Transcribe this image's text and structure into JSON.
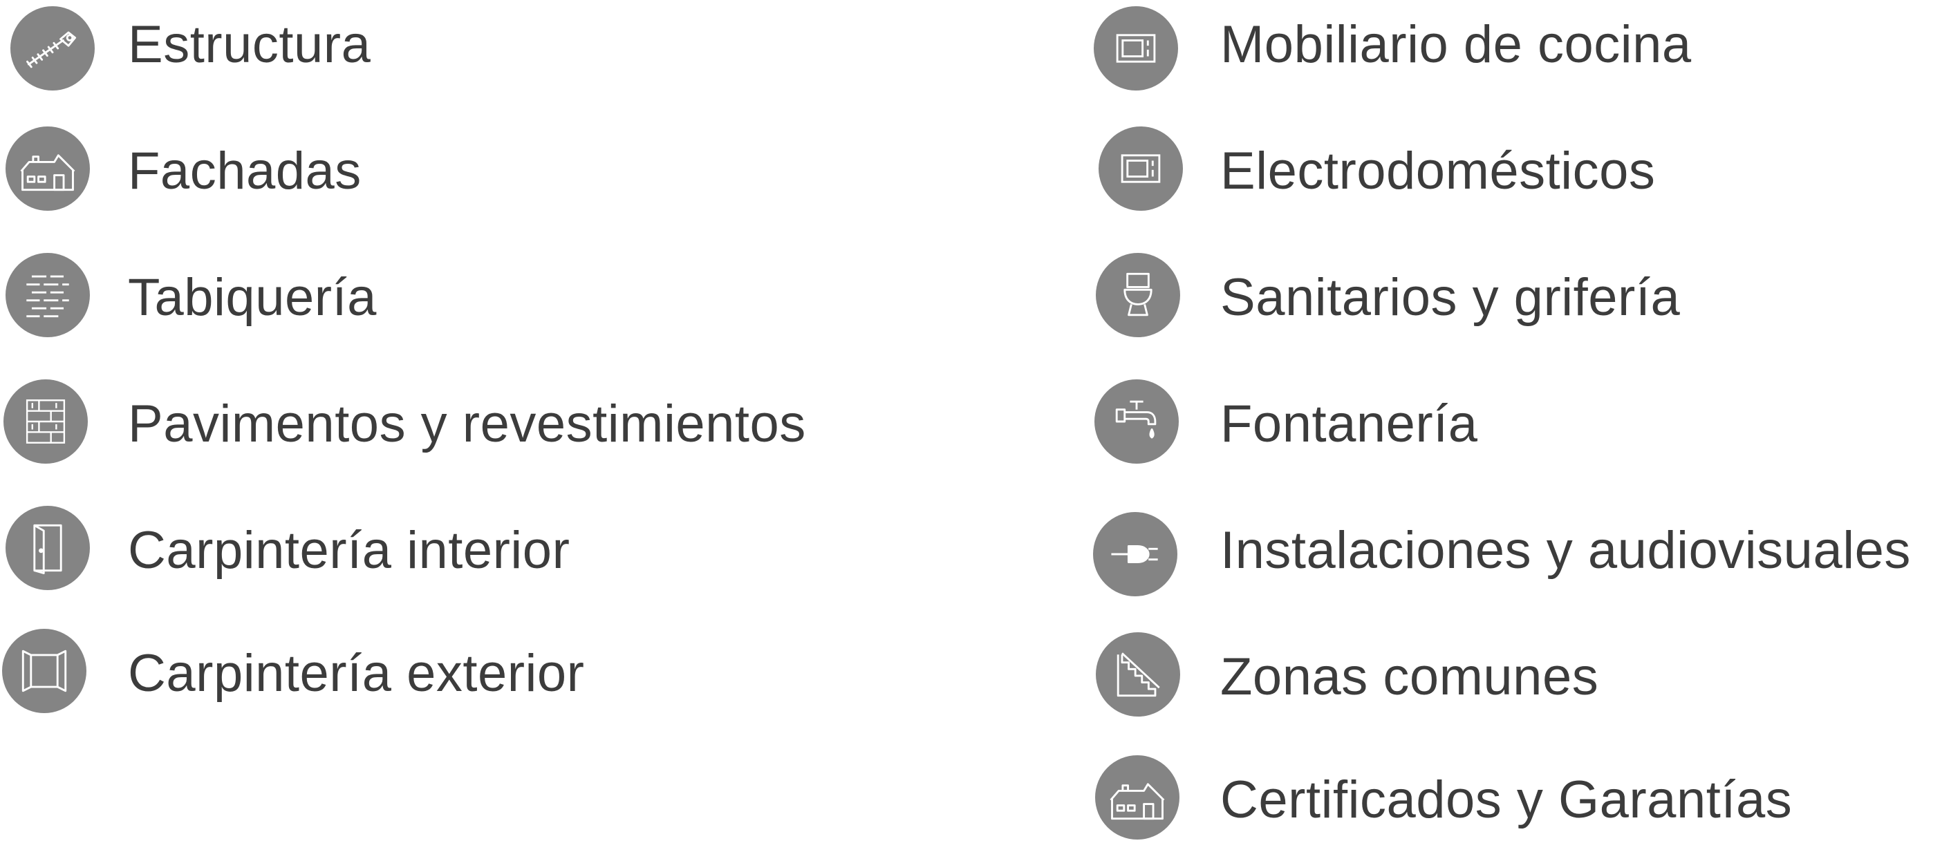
{
  "left_column": {
    "items": [
      {
        "label": "Estructura",
        "icon": "screw-icon"
      },
      {
        "label": "Fachadas",
        "icon": "house-icon"
      },
      {
        "label": "Tabiquería",
        "icon": "brick-wall-icon"
      },
      {
        "label": "Pavimentos y revestimientos",
        "icon": "tile-pattern-icon"
      },
      {
        "label": "Carpintería interior",
        "icon": "door-icon"
      },
      {
        "label": "Carpintería exterior",
        "icon": "window-icon"
      }
    ]
  },
  "right_column": {
    "items": [
      {
        "label": "Mobiliario de cocina",
        "icon": "microwave-icon"
      },
      {
        "label": "Electrodomésticos",
        "icon": "appliance-icon"
      },
      {
        "label": "Sanitarios y grifería",
        "icon": "toilet-icon"
      },
      {
        "label": "Fontanería",
        "icon": "faucet-icon"
      },
      {
        "label": "Instalaciones y audiovisuales",
        "icon": "plug-icon"
      },
      {
        "label": "Zonas comunes",
        "icon": "stairs-icon"
      },
      {
        "label": "Certificados y Garantías",
        "icon": "house-icon"
      }
    ]
  },
  "colors": {
    "icon_background": "#848484",
    "icon_stroke": "#ffffff",
    "text": "#3c3c3c"
  }
}
